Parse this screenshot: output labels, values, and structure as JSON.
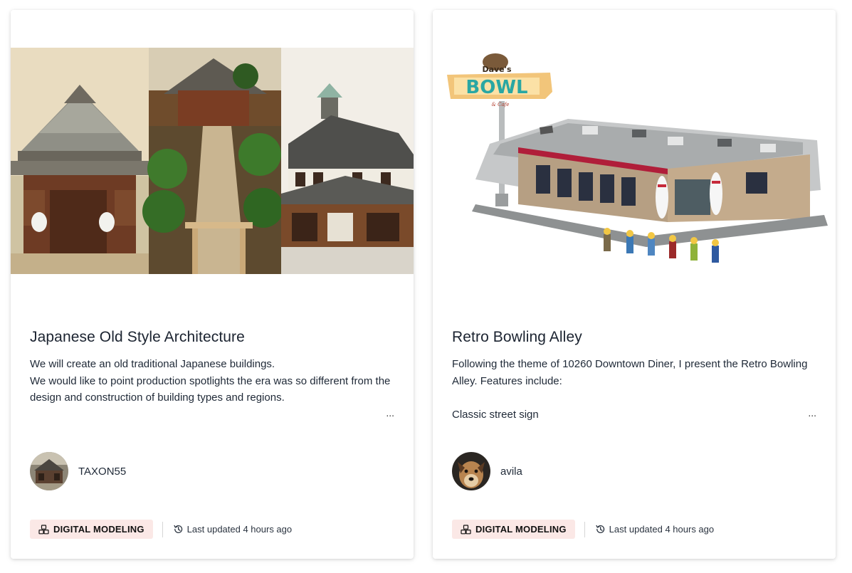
{
  "cards": [
    {
      "title": "Japanese Old Style Architecture",
      "description": [
        "We will create an old traditional Japanese buildings.",
        "We would like to point production spotlights the era was so different from the design and construction of building types and regions."
      ],
      "ellipsis": "...",
      "author": "TAXON55",
      "tag": "DIGITAL MODELING",
      "updated": "Last updated 4 hours ago"
    },
    {
      "title": "Retro Bowling Alley",
      "description": [
        "Following the theme of 10260 Downtown Diner, I present the Retro Bowling Alley. Features include:",
        "",
        "Classic street sign"
      ],
      "ellipsis": "...",
      "author": "avila",
      "tag": "DIGITAL MODELING",
      "updated": "Last updated 4 hours ago",
      "sign_text": {
        "top": "Dave's",
        "main": "BOWL",
        "sub": "& Cafe"
      }
    }
  ],
  "colors": {
    "tag_bg": "#fbe8e6",
    "title": "#1b2330"
  },
  "icons": {
    "tag": "cubes-icon",
    "updated": "history-icon"
  }
}
